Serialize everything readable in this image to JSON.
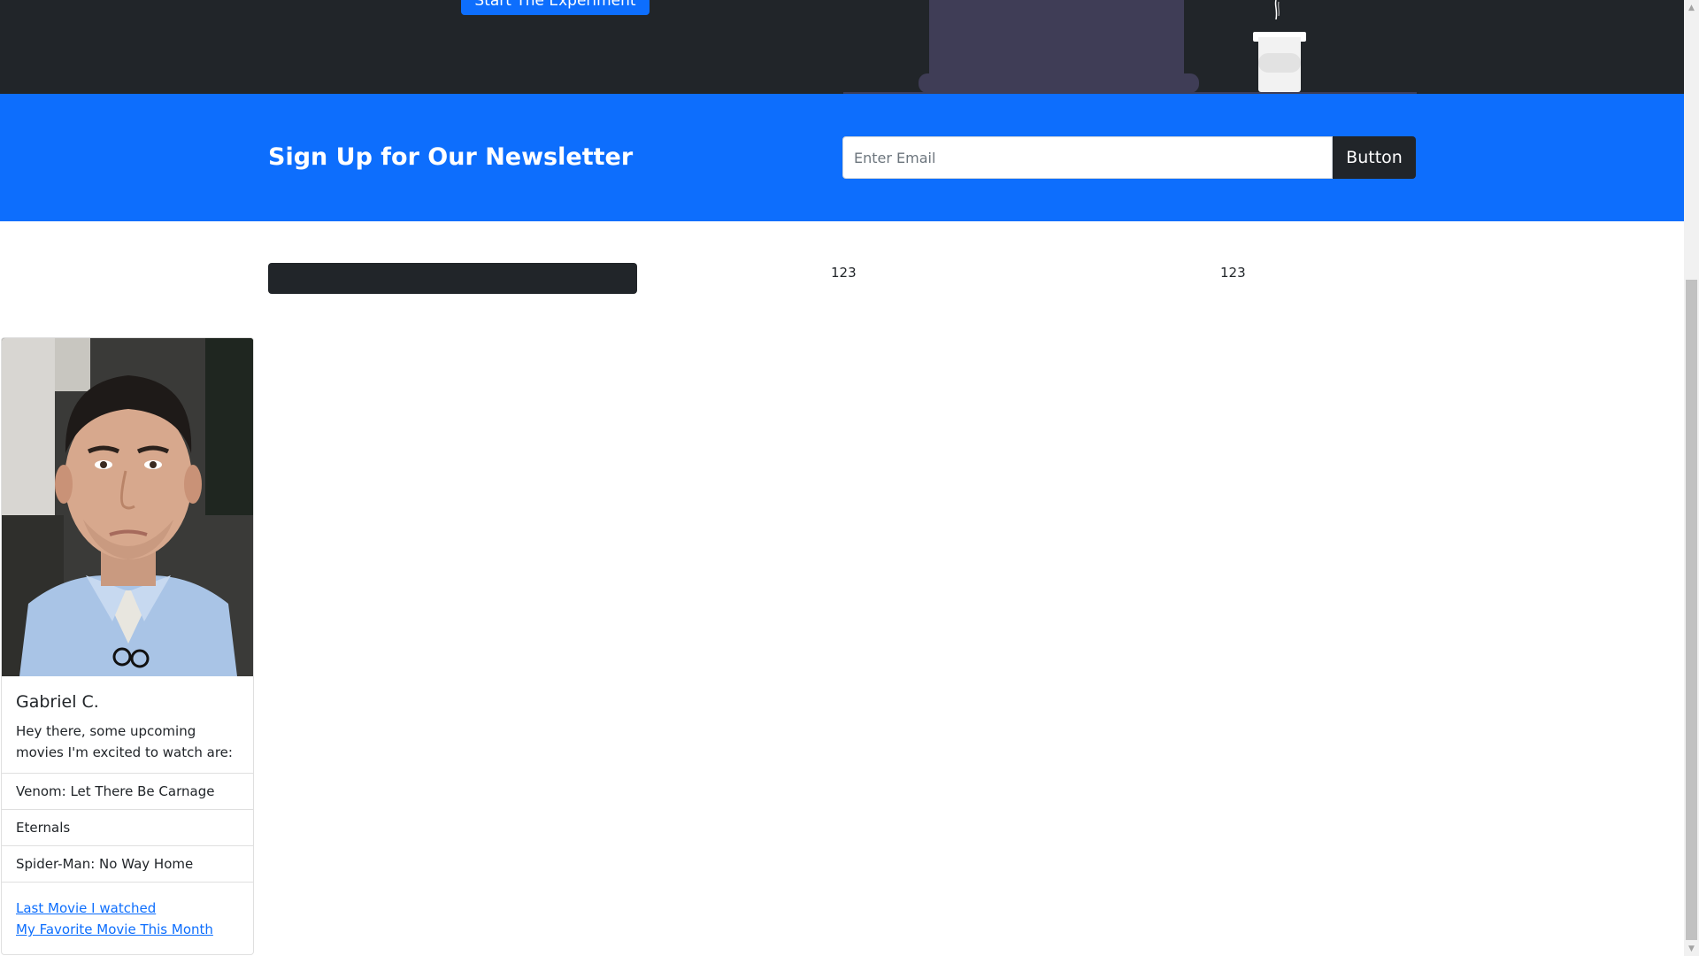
{
  "hero": {
    "cta_label": "Start The Experiment"
  },
  "newsletter": {
    "title": "Sign Up for Our Newsletter",
    "email_placeholder": "Enter Email",
    "button_label": "Button"
  },
  "stats": {
    "value_1": "123",
    "value_2": "123"
  },
  "profile": {
    "name": "Gabriel C.",
    "intro": "Hey there, some upcoming movies I'm excited to watch are:",
    "movies": [
      "Venom: Let There Be Carnage",
      "Eternals",
      "Spider-Man: No Way Home"
    ],
    "links": {
      "last_movie": "Last Movie I watched",
      "favorite_movie": "My Favorite Movie This Month"
    }
  },
  "colors": {
    "primary": "#0d6efd",
    "dark": "#212529",
    "illustration": "#3f3d56"
  }
}
